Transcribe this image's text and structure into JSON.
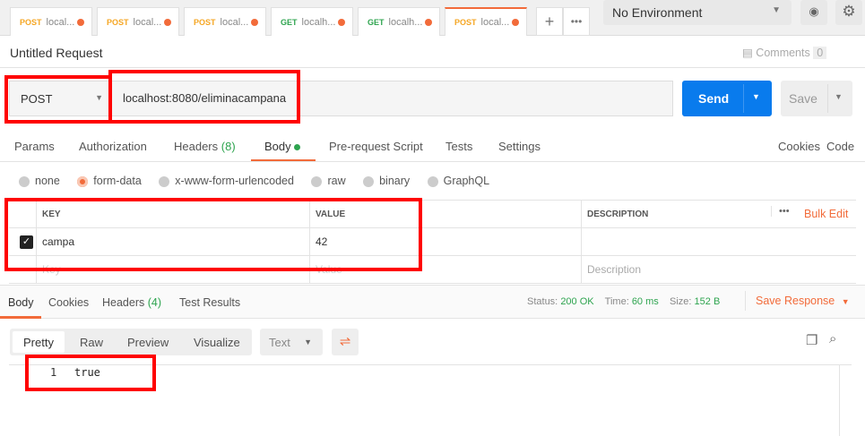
{
  "tabs": [
    {
      "method": "POST",
      "label": "local..."
    },
    {
      "method": "POST",
      "label": "local..."
    },
    {
      "method": "POST",
      "label": "local..."
    },
    {
      "method": "GET",
      "label": "localh..."
    },
    {
      "method": "GET",
      "label": "localh..."
    },
    {
      "method": "POST",
      "label": "local..."
    }
  ],
  "environment": "No Environment",
  "request_title": "Untitled Request",
  "comments": {
    "label": "Comments",
    "count": "0"
  },
  "method": "POST",
  "url": "localhost:8080/eliminacampana",
  "send": "Send",
  "save": "Save",
  "req_tabs": {
    "params": "Params",
    "authorization": "Authorization",
    "headers": "Headers",
    "headers_count": "(8)",
    "body": "Body",
    "prerequest": "Pre-request Script",
    "tests": "Tests",
    "settings": "Settings",
    "cookies": "Cookies",
    "code": "Code"
  },
  "body_types": [
    "none",
    "form-data",
    "x-www-form-urlencoded",
    "raw",
    "binary",
    "GraphQL"
  ],
  "table": {
    "key": "KEY",
    "value": "VALUE",
    "description": "DESCRIPTION",
    "bulk_edit": "Bulk Edit",
    "rows": [
      {
        "key": "campa",
        "value": "42",
        "description": ""
      }
    ],
    "placeholder": {
      "key": "Key",
      "value": "Value",
      "description": "Description"
    }
  },
  "resp_tabs": {
    "body": "Body",
    "cookies": "Cookies",
    "headers": "Headers",
    "headers_count": "(4)",
    "test_results": "Test Results"
  },
  "status": {
    "status_label": "Status:",
    "status": "200 OK",
    "time_label": "Time:",
    "time": "60 ms",
    "size_label": "Size:",
    "size": "152 B",
    "save_response": "Save Response"
  },
  "view": {
    "pretty": "Pretty",
    "raw": "Raw",
    "preview": "Preview",
    "visualize": "Visualize",
    "format": "Text"
  },
  "code": {
    "line": "1",
    "text": "true"
  }
}
